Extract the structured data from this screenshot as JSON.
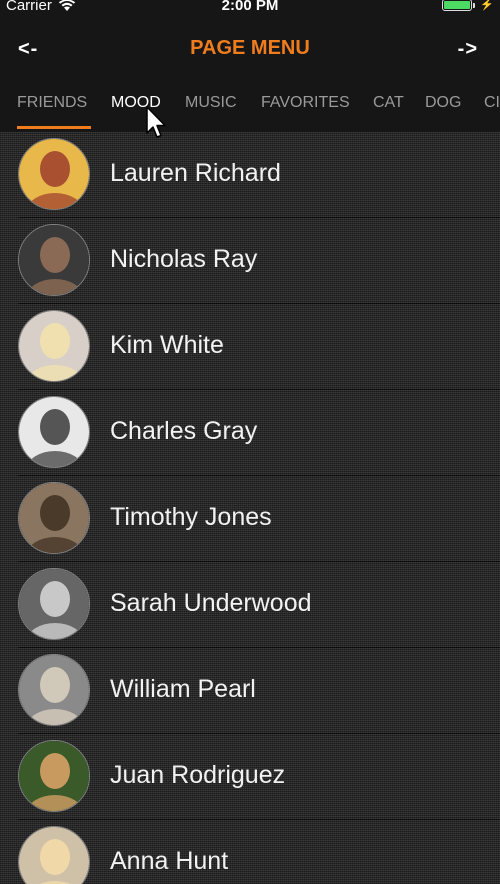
{
  "status_bar": {
    "carrier": "Carrier",
    "time": "2:00 PM",
    "wifi_icon": "wifi-icon",
    "battery_icon": "battery-icon",
    "battery_level": 1.0
  },
  "nav": {
    "back_label": "<-",
    "title": "PAGE MENU",
    "forward_label": "->",
    "title_color": "#f07d1d"
  },
  "tabs": [
    {
      "label": "FRIENDS"
    },
    {
      "label": "MOOD"
    },
    {
      "label": "MUSIC"
    },
    {
      "label": "FAVORITES"
    },
    {
      "label": "CAT"
    },
    {
      "label": "DOG"
    },
    {
      "label": "CI"
    }
  ],
  "active_tab": "FRIENDS",
  "accent_color": "#f07d1d",
  "contacts": [
    {
      "name": "Lauren Richard",
      "avatar_bg": "#e8b84a",
      "avatar_fg": "#a85030"
    },
    {
      "name": "Nicholas Ray",
      "avatar_bg": "#3a3a3a",
      "avatar_fg": "#8a6a55"
    },
    {
      "name": "Kim White",
      "avatar_bg": "#d8d0c8",
      "avatar_fg": "#f0e0b0"
    },
    {
      "name": "Charles Gray",
      "avatar_bg": "#e8e8e8",
      "avatar_fg": "#555555"
    },
    {
      "name": "Timothy Jones",
      "avatar_bg": "#8a7560",
      "avatar_fg": "#4a3a2a"
    },
    {
      "name": "Sarah Underwood",
      "avatar_bg": "#666666",
      "avatar_fg": "#c8c8c8"
    },
    {
      "name": "William Pearl",
      "avatar_bg": "#8a8a8a",
      "avatar_fg": "#d0c8b8"
    },
    {
      "name": "Juan Rodriguez",
      "avatar_bg": "#3a5a2a",
      "avatar_fg": "#c89a60"
    },
    {
      "name": "Anna Hunt",
      "avatar_bg": "#cfc0a8",
      "avatar_fg": "#f0d8a8"
    }
  ]
}
